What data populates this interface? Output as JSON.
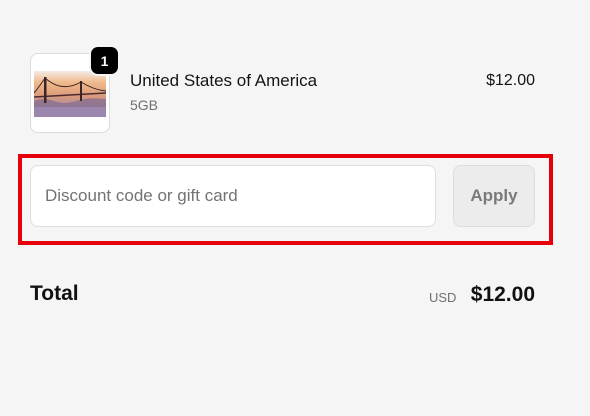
{
  "line_item": {
    "image_alt": "Golden Gate Bridge at sunset",
    "quantity": "1",
    "name": "United States of America",
    "variant": "5GB",
    "price": "$12.00"
  },
  "discount": {
    "placeholder": "Discount code or gift card",
    "value": "",
    "apply_label": "Apply"
  },
  "summary": {
    "total_label": "Total",
    "currency": "USD",
    "total_amount": "$12.00"
  },
  "colors": {
    "background": "#f5f5f5",
    "highlight_outline": "#e6000a",
    "badge": "#000000",
    "apply_button_bg": "#ececec",
    "apply_button_text": "#7a7a7a"
  }
}
